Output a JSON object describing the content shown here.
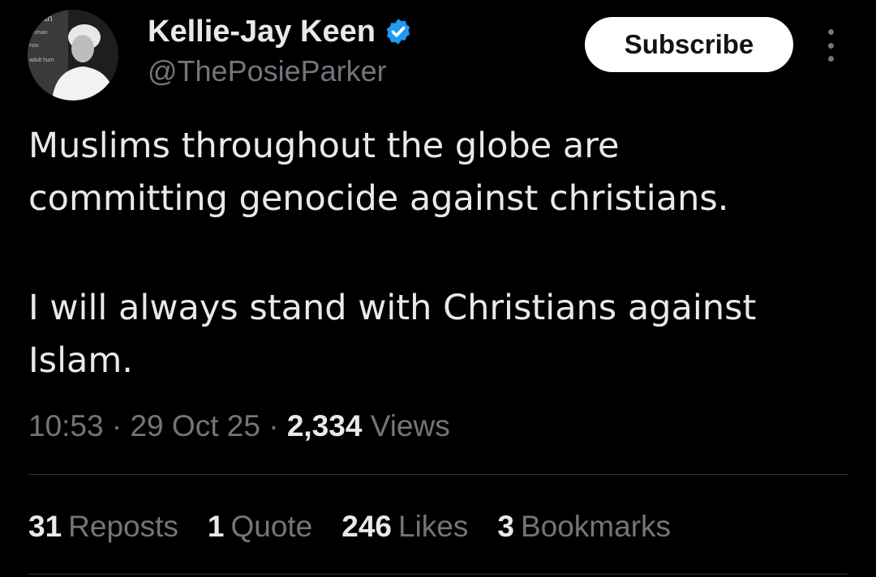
{
  "user": {
    "display_name": "Kellie-Jay Keen",
    "handle": "@ThePosieParker",
    "verified": true
  },
  "subscribe_label": "Subscribe",
  "tweet": {
    "paragraphs": [
      "Muslims throughout the globe are",
      "committing genocide against christians.",
      "I will always stand with Christians against",
      "Islam."
    ]
  },
  "meta": {
    "time": "10:53",
    "separator": "·",
    "date": "29 Oct 25",
    "views_count": "2,334",
    "views_label": "Views"
  },
  "stats": [
    {
      "count": "31",
      "label": "Reposts"
    },
    {
      "count": "1",
      "label": "Quote"
    },
    {
      "count": "246",
      "label": "Likes"
    },
    {
      "count": "3",
      "label": "Bookmarks"
    }
  ],
  "avatar": {
    "poster_text_1": "oman",
    "poster_text_2": "woman",
    "poster_text_3": "nou",
    "poster_text_4": "adult hum"
  },
  "colors": {
    "background": "#000000",
    "text": "#e7e9ea",
    "secondary": "#71767b",
    "verified_blue": "#1d9bf0",
    "divider": "#2f3336"
  },
  "icons": {
    "verified": "verified-badge-icon",
    "more": "more-options-icon"
  }
}
